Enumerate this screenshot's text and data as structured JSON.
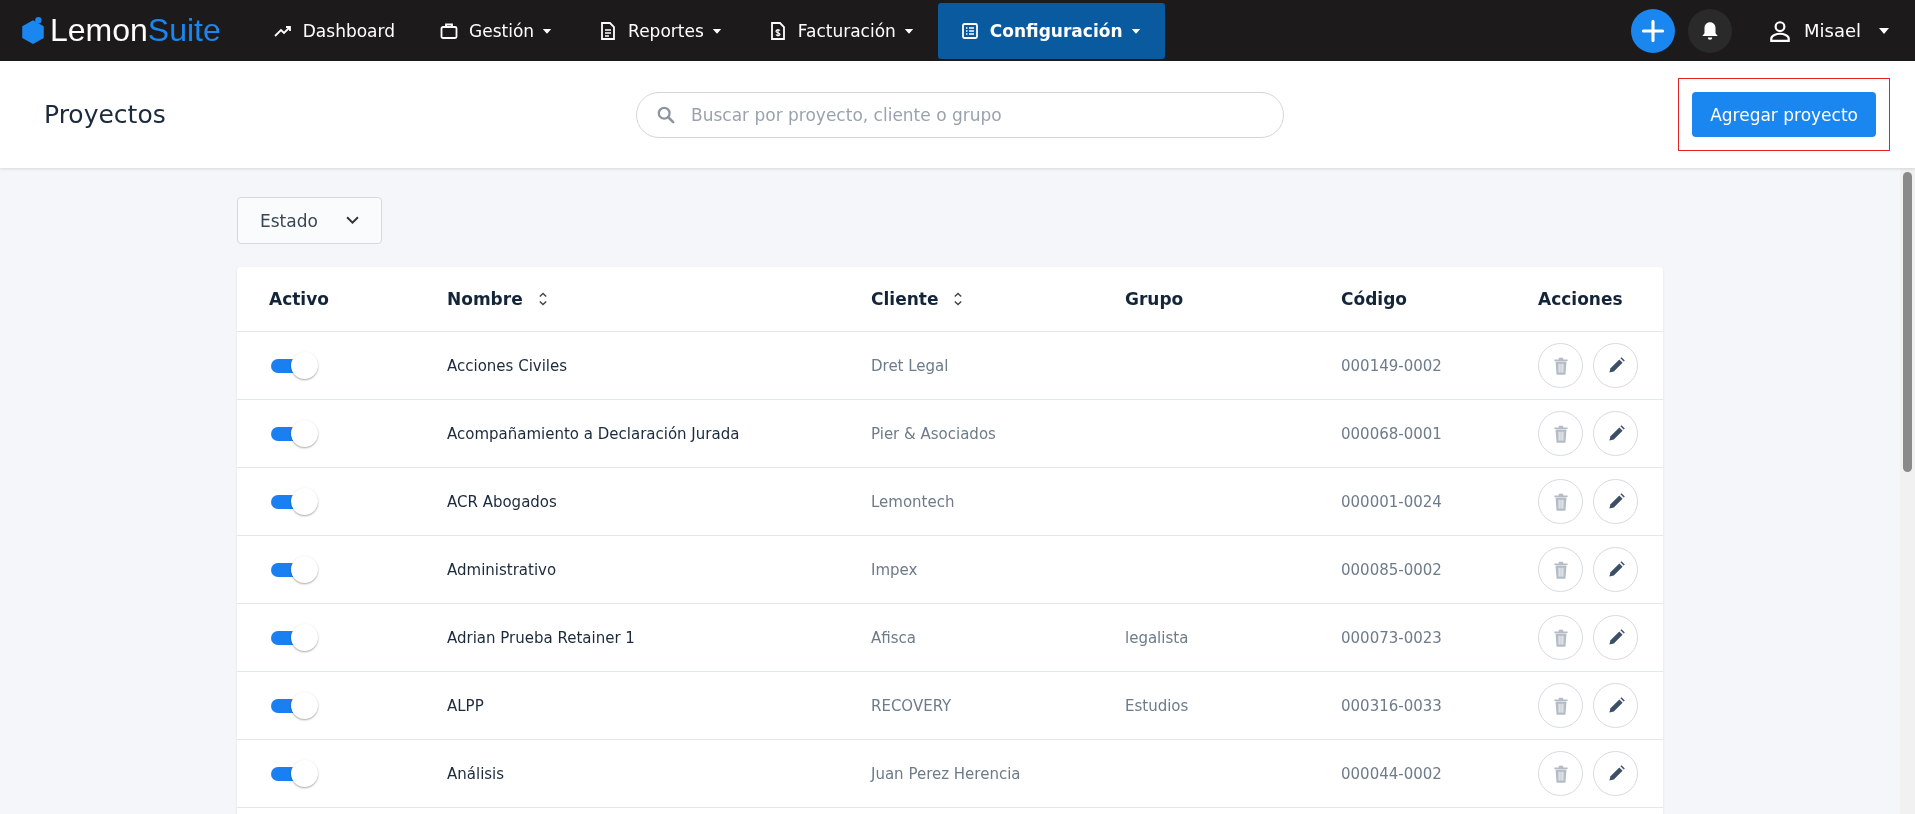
{
  "brand": {
    "part_1": "Lemon",
    "part_2": "Suite"
  },
  "nav": [
    {
      "label": "Dashboard",
      "kind": "link",
      "selected": false
    },
    {
      "label": "Gestión",
      "kind": "menu",
      "selected": false
    },
    {
      "label": "Reportes",
      "kind": "menu",
      "selected": false
    },
    {
      "label": "Facturación",
      "kind": "menu",
      "selected": false
    },
    {
      "label": "Configuración",
      "kind": "menu",
      "selected": true
    }
  ],
  "user": {
    "name": "Misael"
  },
  "page_title": "Proyectos",
  "search": {
    "placeholder": "Buscar por proyecto, cliente o grupo"
  },
  "add_button": "Agregar proyecto",
  "filter": {
    "label": "Estado"
  },
  "table": {
    "columns": [
      {
        "label": "Activo",
        "kind": "plain"
      },
      {
        "label": "Nombre",
        "kind": "sortable"
      },
      {
        "label": "Cliente",
        "kind": "sortable"
      },
      {
        "label": "Grupo",
        "kind": "plain"
      },
      {
        "label": "Código",
        "kind": "plain"
      },
      {
        "label": "Acciones",
        "kind": "plain"
      }
    ],
    "rows": [
      {
        "active": true,
        "name": "Acciones Civiles",
        "client": "Dret Legal",
        "group": "",
        "code": "000149-0002"
      },
      {
        "active": true,
        "name": "Acompañamiento a Declaración Jurada",
        "client": "Pier & Asociados",
        "group": "",
        "code": "000068-0001"
      },
      {
        "active": true,
        "name": "ACR Abogados",
        "client": "Lemontech",
        "group": "",
        "code": "000001-0024"
      },
      {
        "active": true,
        "name": "Administrativo",
        "client": "Impex",
        "group": "",
        "code": "000085-0002"
      },
      {
        "active": true,
        "name": "Adrian Prueba Retainer 1",
        "client": "Afisca",
        "group": "legalista",
        "code": "000073-0023"
      },
      {
        "active": true,
        "name": "ALPP",
        "client": "RECOVERY",
        "group": "Estudios",
        "code": "000316-0033"
      },
      {
        "active": true,
        "name": "Análisis",
        "client": "Juan Perez Herencia",
        "group": "",
        "code": "000044-0002"
      }
    ]
  }
}
